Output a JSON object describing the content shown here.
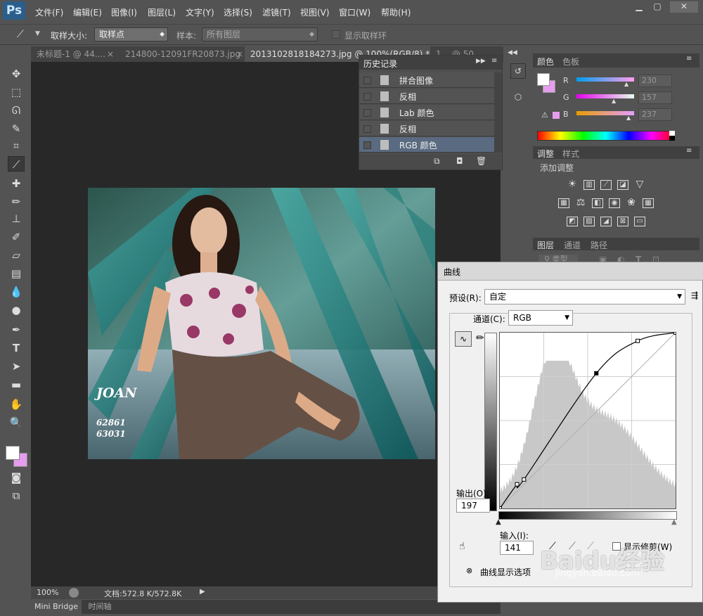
{
  "app": {
    "logo": "Ps"
  },
  "menu": {
    "items": [
      "文件(F)",
      "编辑(E)",
      "图像(I)",
      "图层(L)",
      "文字(Y)",
      "选择(S)",
      "滤镜(T)",
      "视图(V)",
      "窗口(W)",
      "帮助(H)"
    ]
  },
  "options": {
    "sample_size_label": "取样大小:",
    "sample_size_value": "取样点",
    "sample_label": "样本:",
    "sample_value": "所有图层",
    "show_ring_label": "显示取样环"
  },
  "tabs": [
    {
      "label": "未标题-1 @ 44....",
      "close": "×"
    },
    {
      "label": "214800-12091FR20873.jpg",
      "close": "×"
    },
    {
      "label": "20131028181842​73.jpg @ 100%(RGB/8) *",
      "close": "×"
    },
    {
      "label": "1...  @ 50...",
      "close": ""
    }
  ],
  "photo": {
    "watermark_name": "JOAN",
    "watermark_num1": "62861",
    "watermark_num2": "63031"
  },
  "status": {
    "zoom": "100%",
    "doc": "文档:572.8 K/572.8K"
  },
  "bottom_tabs": {
    "mini_bridge": "Mini Bridge",
    "timeline": "时间轴"
  },
  "history": {
    "title": "历史记录",
    "items": [
      {
        "label": "拼合图像"
      },
      {
        "label": "反相"
      },
      {
        "label": "Lab 颜色"
      },
      {
        "label": "反相"
      },
      {
        "label": "RGB 颜色",
        "selected": true
      }
    ]
  },
  "color_panel": {
    "tab_color": "颜色",
    "tab_swatches": "色板",
    "r_label": "R",
    "g_label": "G",
    "b_label": "B",
    "r_value": "230",
    "g_value": "157",
    "b_value": "237",
    "foreground": "#ffffff",
    "background": "#e69ded"
  },
  "adjust_panel": {
    "tab_adjust": "调整",
    "tab_style": "样式",
    "heading": "添加调整"
  },
  "layers_panel": {
    "tab_layers": "图层",
    "tab_channels": "通道",
    "tab_paths": "路径",
    "kind": "类型"
  },
  "curves": {
    "title": "曲线",
    "preset_label": "预设(R):",
    "preset_value": "自定",
    "channel_label": "通道(C):",
    "channel_value": "RGB",
    "output_label": "输出(O):",
    "output_value": "197",
    "input_label": "输入(I):",
    "input_value": "141",
    "show_clipping_label": "显示修剪(W)",
    "display_options_label": "曲线显示选项",
    "curve_points": [
      [
        0,
        0
      ],
      [
        25,
        35
      ],
      [
        35,
        42
      ],
      [
        140,
        196
      ],
      [
        200,
        243
      ],
      [
        255,
        255
      ]
    ]
  },
  "watermark": {
    "text": "Baidu经验",
    "url": "jingyan.baidu.com"
  }
}
